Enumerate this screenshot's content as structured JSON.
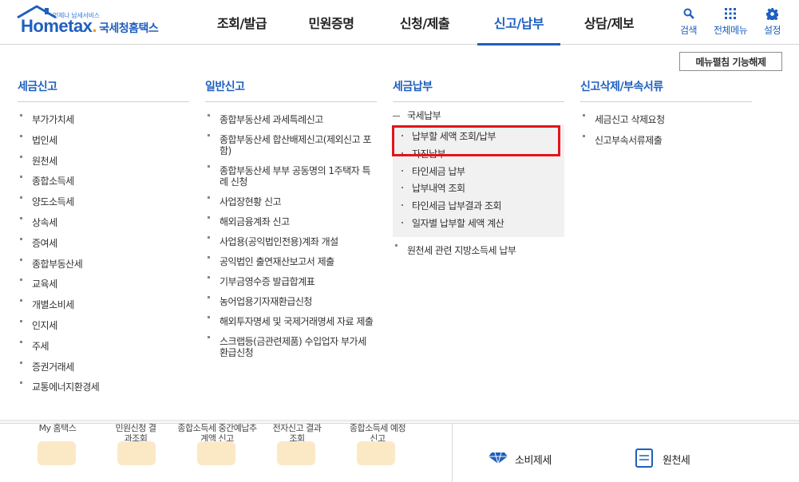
{
  "header": {
    "logo": {
      "tagline": "언제나 납세서비스",
      "brand": "Hometax",
      "brand_dot": ".",
      "brand_kr": "국세청홈택스"
    },
    "nav": [
      {
        "label": "조회/발급",
        "active": false
      },
      {
        "label": "민원증명",
        "active": false
      },
      {
        "label": "신청/제출",
        "active": false
      },
      {
        "label": "신고/납부",
        "active": true
      },
      {
        "label": "상담/제보",
        "active": false
      }
    ],
    "util": {
      "search": "검색",
      "all_menu": "전체메뉴",
      "settings": "설정"
    },
    "accent": "#1f5fbf"
  },
  "release_button": "메뉴펼침 기능해제",
  "columns": {
    "tax_filing": {
      "title": "세금신고",
      "items": [
        "부가가치세",
        "법인세",
        "원천세",
        "종합소득세",
        "양도소득세",
        "상속세",
        "증여세",
        "종합부동산세",
        "교육세",
        "개별소비세",
        "인지세",
        "주세",
        "증권거래세",
        "교통에너지환경세"
      ]
    },
    "general_filing": {
      "title": "일반신고",
      "items": [
        "종합부동산세 과세특례신고",
        "종합부동산세 합산배제신고(제외신고 포함)",
        "종합부동산세 부부 공동명의 1주택자 특례 신청",
        "사업장현황 신고",
        "해외금융계좌 신고",
        "사업용(공익법인전용)계좌 개설",
        "공익법인 출연재산보고서 제출",
        "기부금영수증 발급합계표",
        "농어업용기자재환급신청",
        "해외투자명세 및 국제거래명세 자료 제출",
        "스크랩등(금관련제품) 수입업자 부가세 환급신청"
      ]
    },
    "tax_payment": {
      "title": "세금납부",
      "sub_head": "국세납부",
      "sub_items": [
        "납부할 세액 조회/납부",
        "자진납부",
        "타인세금 납부",
        "납부내역 조회",
        "타인세금 납부결과 조회",
        "일자별 납부할 세액 계산"
      ],
      "after_items": [
        "원천세 관련 지방소득세 납부"
      ]
    },
    "deletion": {
      "title": "신고삭제/부속서류",
      "items": [
        "세금신고 삭제요청",
        "신고부속서류제출"
      ]
    }
  },
  "underlay": {
    "left_items": [
      "My 홈택스",
      "민원신청 결과조회",
      "종합소득세 중간예납추계액 신고",
      "전자신고 결과조회",
      "종합소득세 예정신고"
    ],
    "right_items": [
      "소비제세",
      "원천세"
    ]
  }
}
